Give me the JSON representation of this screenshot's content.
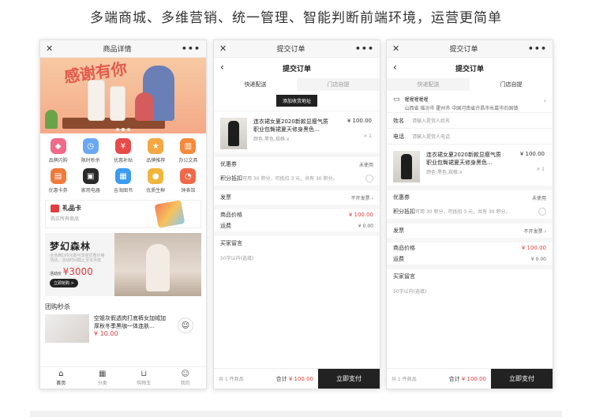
{
  "headline": "多端商城、多维营销、统一管理、智能判断前端环境，运营更简单",
  "phone1": {
    "title": "商品详情",
    "close_icon": "close-icon",
    "more_icon": "more-icon",
    "banner_text": "感谢有你",
    "categories": [
      {
        "label": "品牌闪购",
        "color": "#f06a8a",
        "icon": "bag-icon"
      },
      {
        "label": "限时秒杀",
        "color": "#6ba8f2",
        "icon": "clock-icon"
      },
      {
        "label": "优惠补贴",
        "color": "#e84a4a",
        "icon": "coin-icon"
      },
      {
        "label": "品牌推荐",
        "color": "#f5a742",
        "icon": "star-icon"
      },
      {
        "label": "办公文具",
        "color": "#f58a3c",
        "icon": "book-icon"
      },
      {
        "label": "优惠卡券",
        "color": "#f07a3c",
        "icon": "ticket-icon"
      },
      {
        "label": "家用电器",
        "color": "#2a2a2a",
        "icon": "appliance-icon"
      },
      {
        "label": "吉海图书",
        "color": "#3c9cf0",
        "icon": "library-icon"
      },
      {
        "label": "优质生鲜",
        "color": "#f0b63c",
        "icon": "fruit-icon"
      },
      {
        "label": "钟表馆",
        "color": "#f06a4a",
        "icon": "clock-face-icon"
      }
    ],
    "giftcard": {
      "title": "礼品卡",
      "subtitle": "购买所有商品"
    },
    "promo": {
      "title": "梦幻森林",
      "desc": "全场满199元即可享受优惠价格活动，活动时间截止至本月底",
      "price_label": "活动价",
      "price": "¥3000",
      "button": "立即抢购 >"
    },
    "section_title": "团购秒杀",
    "seckill": {
      "name": "空姐灰假透肉打底裤女加绒加厚秋冬季黑咖一体连肤…",
      "price": "¥ 10.00"
    },
    "tabs": [
      {
        "label": "首页",
        "icon": "home-icon"
      },
      {
        "label": "分类",
        "icon": "grid-icon"
      },
      {
        "label": "购物车",
        "icon": "cart-icon"
      },
      {
        "label": "我的",
        "icon": "user-icon"
      }
    ]
  },
  "order": {
    "window_title": "提交订单",
    "page_title": "提交订单",
    "seg_delivery": "快递配送",
    "seg_pickup": "门店自提",
    "add_address": "添加收货地址",
    "item_name": "连衣裙女夏2020新款显瘦气质职业包臀裙夏天修身黑色…",
    "item_spec": "颜色:黑色,规格:x",
    "item_price": "¥ 100.00",
    "item_qty": "× 1",
    "coupon_label": "优惠券",
    "coupon_value": "未使用",
    "points_label": "积分抵扣",
    "points_desc": "可用 30 积分，可抵扣 3 元，共有 30 积分。",
    "invoice_label": "发票",
    "invoice_value": "不开发票",
    "goods_price_label": "商品价格",
    "goods_price": "¥ 100.00",
    "shipping_label": "运费",
    "shipping": "¥ 0.00",
    "message_label": "买家留言",
    "message_placeholder": "50字以内(选填)",
    "count": "共 1 件商品",
    "total_label": "合计",
    "total": "¥ 100.00",
    "pay": "立即支付"
  },
  "pickup": {
    "store_name": "喔喔喔喔喔",
    "store_addr": "山西省 临汾市 霍州市 中国河南省许昌市长葛市石固镇",
    "name_label": "姓名",
    "name_placeholder": "请输入提货人姓名",
    "phone_label": "电话",
    "phone_placeholder": "请输入提货人电话"
  }
}
